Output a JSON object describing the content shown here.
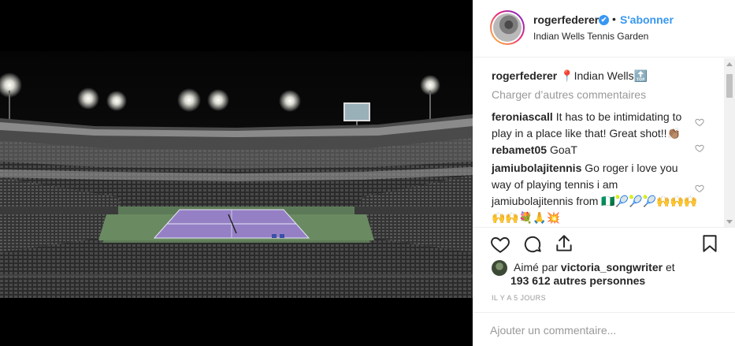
{
  "post": {
    "image_alt": "Indian Wells stadium at night",
    "header": {
      "username": "rogerfederer",
      "dot": "•",
      "follow_label": "S'abonner",
      "location": "Indian Wells Tennis Garden",
      "verified_glyph": "✔"
    },
    "caption": {
      "username": "rogerfederer",
      "text": "📍Indian Wells🔝"
    },
    "load_more_label": "Charger d’autres commentaires",
    "comments": [
      {
        "username": "feroniascall",
        "text": "It has to be intimidating to play in a place like that! Great shot!!👏🏽"
      },
      {
        "username": "rebamet05",
        "text": "GoaT"
      },
      {
        "username": "jamiubolajitennis",
        "text": "Go roger i love you way of playing tennis i am jamiubolajitennis from 🇳🇬🎾🎾🎾🙌🙌🙌🙌🙌💐🙏💥"
      }
    ],
    "likes": {
      "prefix": "Aimé par",
      "liker": "victoria_songwriter",
      "joiner": "et",
      "others": "193 612 autres personnes"
    },
    "timestamp": "IL Y A 5 JOURS",
    "add_comment_placeholder": "Ajouter un commentaire..."
  },
  "colors": {
    "accent": "#3897f0",
    "muted": "#999999",
    "text": "#262626",
    "court": "#8f78c4"
  },
  "icons": [
    "heart-icon",
    "comment-icon",
    "share-icon",
    "bookmark-icon",
    "verified-icon"
  ]
}
